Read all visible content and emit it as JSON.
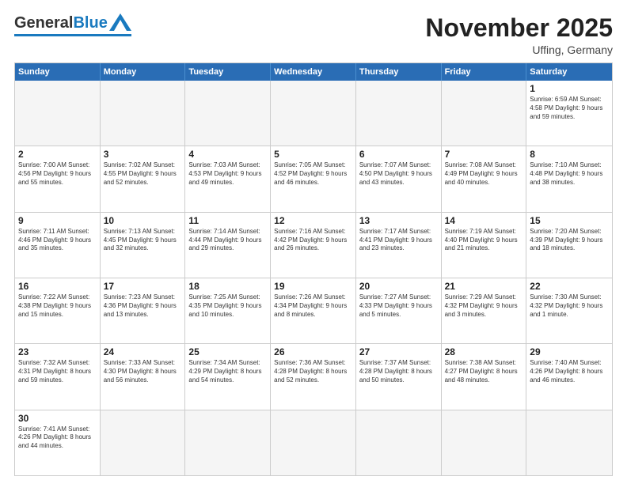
{
  "header": {
    "logo_general": "General",
    "logo_blue": "Blue",
    "month_title": "November 2025",
    "subtitle": "Uffing, Germany"
  },
  "weekdays": [
    "Sunday",
    "Monday",
    "Tuesday",
    "Wednesday",
    "Thursday",
    "Friday",
    "Saturday"
  ],
  "rows": [
    [
      {
        "day": "",
        "info": ""
      },
      {
        "day": "",
        "info": ""
      },
      {
        "day": "",
        "info": ""
      },
      {
        "day": "",
        "info": ""
      },
      {
        "day": "",
        "info": ""
      },
      {
        "day": "",
        "info": ""
      },
      {
        "day": "1",
        "info": "Sunrise: 6:59 AM\nSunset: 4:58 PM\nDaylight: 9 hours\nand 59 minutes."
      }
    ],
    [
      {
        "day": "2",
        "info": "Sunrise: 7:00 AM\nSunset: 4:56 PM\nDaylight: 9 hours\nand 55 minutes."
      },
      {
        "day": "3",
        "info": "Sunrise: 7:02 AM\nSunset: 4:55 PM\nDaylight: 9 hours\nand 52 minutes."
      },
      {
        "day": "4",
        "info": "Sunrise: 7:03 AM\nSunset: 4:53 PM\nDaylight: 9 hours\nand 49 minutes."
      },
      {
        "day": "5",
        "info": "Sunrise: 7:05 AM\nSunset: 4:52 PM\nDaylight: 9 hours\nand 46 minutes."
      },
      {
        "day": "6",
        "info": "Sunrise: 7:07 AM\nSunset: 4:50 PM\nDaylight: 9 hours\nand 43 minutes."
      },
      {
        "day": "7",
        "info": "Sunrise: 7:08 AM\nSunset: 4:49 PM\nDaylight: 9 hours\nand 40 minutes."
      },
      {
        "day": "8",
        "info": "Sunrise: 7:10 AM\nSunset: 4:48 PM\nDaylight: 9 hours\nand 38 minutes."
      }
    ],
    [
      {
        "day": "9",
        "info": "Sunrise: 7:11 AM\nSunset: 4:46 PM\nDaylight: 9 hours\nand 35 minutes."
      },
      {
        "day": "10",
        "info": "Sunrise: 7:13 AM\nSunset: 4:45 PM\nDaylight: 9 hours\nand 32 minutes."
      },
      {
        "day": "11",
        "info": "Sunrise: 7:14 AM\nSunset: 4:44 PM\nDaylight: 9 hours\nand 29 minutes."
      },
      {
        "day": "12",
        "info": "Sunrise: 7:16 AM\nSunset: 4:42 PM\nDaylight: 9 hours\nand 26 minutes."
      },
      {
        "day": "13",
        "info": "Sunrise: 7:17 AM\nSunset: 4:41 PM\nDaylight: 9 hours\nand 23 minutes."
      },
      {
        "day": "14",
        "info": "Sunrise: 7:19 AM\nSunset: 4:40 PM\nDaylight: 9 hours\nand 21 minutes."
      },
      {
        "day": "15",
        "info": "Sunrise: 7:20 AM\nSunset: 4:39 PM\nDaylight: 9 hours\nand 18 minutes."
      }
    ],
    [
      {
        "day": "16",
        "info": "Sunrise: 7:22 AM\nSunset: 4:38 PM\nDaylight: 9 hours\nand 15 minutes."
      },
      {
        "day": "17",
        "info": "Sunrise: 7:23 AM\nSunset: 4:36 PM\nDaylight: 9 hours\nand 13 minutes."
      },
      {
        "day": "18",
        "info": "Sunrise: 7:25 AM\nSunset: 4:35 PM\nDaylight: 9 hours\nand 10 minutes."
      },
      {
        "day": "19",
        "info": "Sunrise: 7:26 AM\nSunset: 4:34 PM\nDaylight: 9 hours\nand 8 minutes."
      },
      {
        "day": "20",
        "info": "Sunrise: 7:27 AM\nSunset: 4:33 PM\nDaylight: 9 hours\nand 5 minutes."
      },
      {
        "day": "21",
        "info": "Sunrise: 7:29 AM\nSunset: 4:32 PM\nDaylight: 9 hours\nand 3 minutes."
      },
      {
        "day": "22",
        "info": "Sunrise: 7:30 AM\nSunset: 4:32 PM\nDaylight: 9 hours\nand 1 minute."
      }
    ],
    [
      {
        "day": "23",
        "info": "Sunrise: 7:32 AM\nSunset: 4:31 PM\nDaylight: 8 hours\nand 59 minutes."
      },
      {
        "day": "24",
        "info": "Sunrise: 7:33 AM\nSunset: 4:30 PM\nDaylight: 8 hours\nand 56 minutes."
      },
      {
        "day": "25",
        "info": "Sunrise: 7:34 AM\nSunset: 4:29 PM\nDaylight: 8 hours\nand 54 minutes."
      },
      {
        "day": "26",
        "info": "Sunrise: 7:36 AM\nSunset: 4:28 PM\nDaylight: 8 hours\nand 52 minutes."
      },
      {
        "day": "27",
        "info": "Sunrise: 7:37 AM\nSunset: 4:28 PM\nDaylight: 8 hours\nand 50 minutes."
      },
      {
        "day": "28",
        "info": "Sunrise: 7:38 AM\nSunset: 4:27 PM\nDaylight: 8 hours\nand 48 minutes."
      },
      {
        "day": "29",
        "info": "Sunrise: 7:40 AM\nSunset: 4:26 PM\nDaylight: 8 hours\nand 46 minutes."
      }
    ],
    [
      {
        "day": "30",
        "info": "Sunrise: 7:41 AM\nSunset: 4:26 PM\nDaylight: 8 hours\nand 44 minutes."
      },
      {
        "day": "",
        "info": ""
      },
      {
        "day": "",
        "info": ""
      },
      {
        "day": "",
        "info": ""
      },
      {
        "day": "",
        "info": ""
      },
      {
        "day": "",
        "info": ""
      },
      {
        "day": "",
        "info": ""
      }
    ]
  ]
}
